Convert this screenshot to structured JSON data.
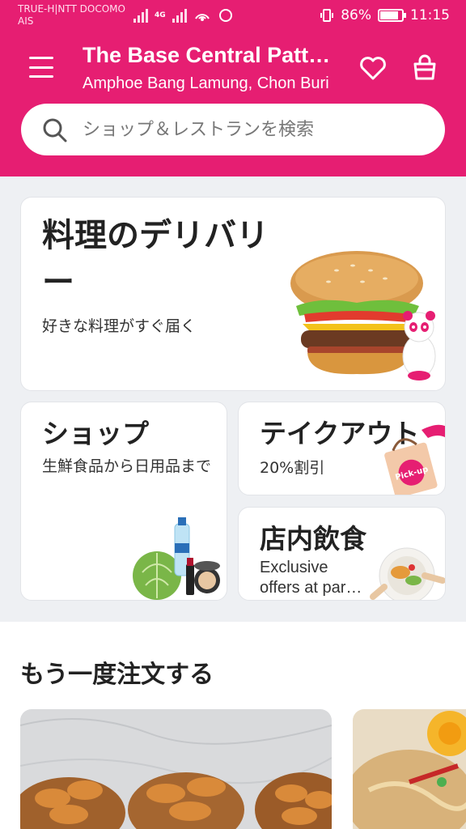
{
  "status_bar": {
    "carrier_line1": "TRUE-H|NTT DOCOMO",
    "carrier_line2": "AIS",
    "network": "4G",
    "battery": "86%",
    "battery_level": 0.86,
    "time": "11:15"
  },
  "header": {
    "title": "The Base Central Pattaya",
    "subtitle": "Amphoe Bang Lamung, Chon Buri",
    "icons": [
      "menu-icon",
      "heart-icon",
      "shopping-bag-icon"
    ]
  },
  "search": {
    "placeholder": "ショップ＆レストランを検索"
  },
  "cards": {
    "food": {
      "title": "料理のデリバリー",
      "desc": "好きな料理がすぐ届く"
    },
    "shop": {
      "title": "ショップ",
      "desc": "生鮮食品から日用品まで"
    },
    "takeaway": {
      "title": "テイクアウト",
      "desc": "20%割引",
      "badge": "Pick-up"
    },
    "dinein": {
      "title": "店内飲食",
      "desc_line1": "Exclusive",
      "desc_line2": "offers at partner restaurants"
    }
  },
  "reorder": {
    "title": "もう一度注文する"
  },
  "colors": {
    "brand": "#e61e72",
    "background": "#eef0f3"
  }
}
